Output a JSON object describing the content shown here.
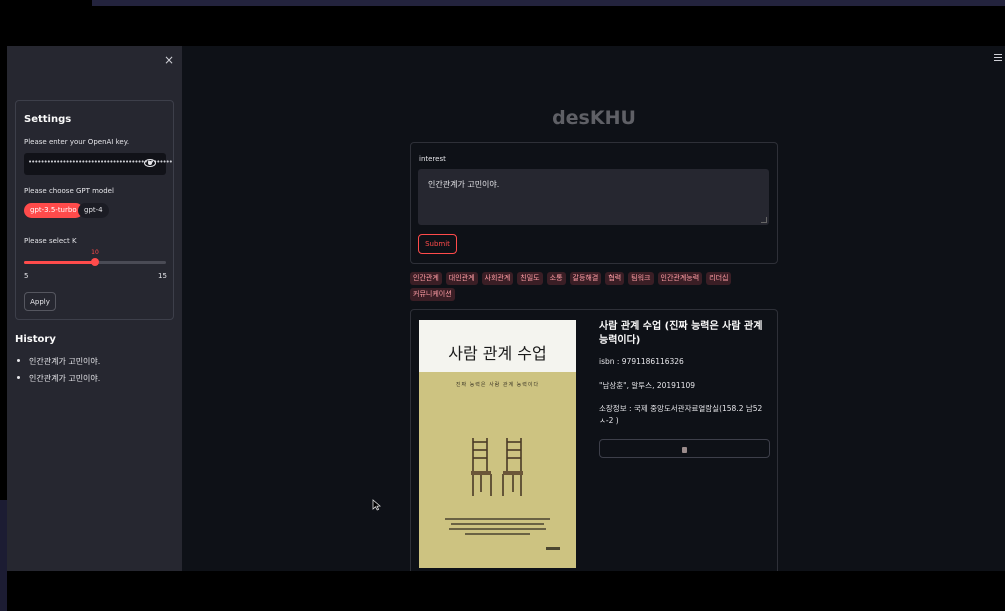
{
  "sidebar": {
    "close_glyph": "×",
    "settings_title": "Settings",
    "api_key_label": "Please enter your OpenAI key.",
    "api_key_masked": "••••••••••••••••••••••••••••••••••••••••••••••",
    "model_label": "Please choose GPT model",
    "models": [
      {
        "label": "gpt-3.5-turbo",
        "selected": true
      },
      {
        "label": "gpt-4",
        "selected": false
      }
    ],
    "k_label": "Please select K",
    "k_value": "10",
    "k_min": "5",
    "k_max": "15",
    "k_fraction": 0.5,
    "apply_label": "Apply",
    "history_title": "History",
    "history": [
      "인간관계가 고민이야.",
      "인간관계가 고민이야."
    ]
  },
  "main": {
    "title": "desKHU",
    "interest_label": "interest",
    "interest_value": "인간관계가 고민이야.",
    "submit_label": "Submit",
    "tags": [
      "인간관계",
      "대인관계",
      "사회관계",
      "친밀도",
      "소통",
      "갈등해결",
      "협력",
      "팀워크",
      "인간관계능력",
      "리더십",
      "커뮤니케이션"
    ],
    "result": {
      "title": "사람 관계 수업 (진짜 능력은 사람 관계 능력이다)",
      "isbn": "isbn : 9791186116326",
      "author": "\"남상훈\", 알투스, 20191109",
      "location": "소장정보 : 국제 중앙도서관자료열람실(158.2 남52 ㅅ-2 )",
      "cover_title": "사람 관계 수업",
      "cover_subtitle": "진짜 능력은 사람 관계 능력이다"
    }
  },
  "colors": {
    "accent": "#ff4b4b",
    "sidebar_bg": "#262730",
    "main_bg": "#0e1117",
    "tag_bg": "#3a1e25",
    "tag_text": "#ff9da5",
    "cover_bg": "#cdc381"
  },
  "icons": {
    "close": "close-icon",
    "visibility": "eye-icon",
    "menu": "hamburger-menu-icon",
    "detail": "book-icon",
    "cursor": "mouse-pointer-icon"
  }
}
